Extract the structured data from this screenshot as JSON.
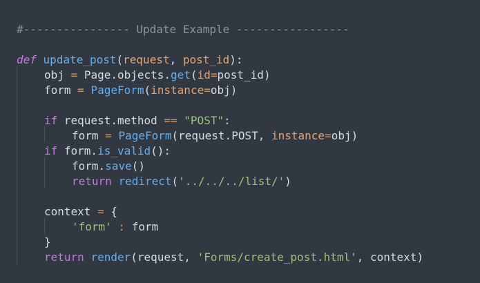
{
  "colors": {
    "background": "#323842",
    "text": "#d7dae0",
    "comment": "#8b939f",
    "keyword": "#c678dd",
    "function": "#61afef",
    "parameter": "#e5a36a",
    "operator": "#d19a66",
    "string": "#98c379",
    "indent_guide": "#4b525e"
  },
  "code": {
    "comment": "#---------------- Update Example -----------------",
    "l_def": "def",
    "l_fn": "update_post",
    "l_paren_open": "(",
    "l_param1": "request",
    "l_comma": ", ",
    "l_param2": "post_id",
    "l_paren_close": "):",
    "obj_name": "obj",
    "obj_eq": " = ",
    "obj_model": "Page.objects.",
    "obj_get": "get",
    "obj_open": "(",
    "obj_kw": "id",
    "obj_kweq": "=",
    "obj_val": "post_id",
    "obj_close": ")",
    "form_name": "form",
    "form_eq": " = ",
    "form_cls": "PageForm",
    "form_open": "(",
    "form_kw": "instance",
    "form_kweq": "=",
    "form_val": "obj",
    "form_close": ")",
    "if1_kw": "if",
    "if1_expr": " request.method ",
    "if1_op": "==",
    "if1_str": " \"POST\"",
    "if1_colon": ":",
    "form2_name": "form",
    "form2_eq": " = ",
    "form2_cls": "PageForm",
    "form2_open": "(request.POST, ",
    "form2_kw": "instance",
    "form2_kweq": "=",
    "form2_val": "obj",
    "form2_close": ")",
    "if2_kw": "if",
    "if2_expr": " form.",
    "if2_method": "is_valid",
    "if2_close": "():",
    "save_obj": "form.",
    "save_method": "save",
    "save_close": "()",
    "ret1_kw": "return",
    "ret1_sp": " ",
    "ret1_fn": "redirect",
    "ret1_open": "(",
    "ret1_str": "'../../../list/'",
    "ret1_close": ")",
    "ctx_name": "context",
    "ctx_eq": " = ",
    "ctx_open": "{",
    "ctx_key": "'form'",
    "ctx_colon": " : ",
    "ctx_val": "form",
    "ctx_close": "}",
    "ret2_kw": "return",
    "ret2_sp": " ",
    "ret2_fn": "render",
    "ret2_args1": "(request, ",
    "ret2_str": "'Forms/create_post.html'",
    "ret2_args2": ", context)"
  }
}
